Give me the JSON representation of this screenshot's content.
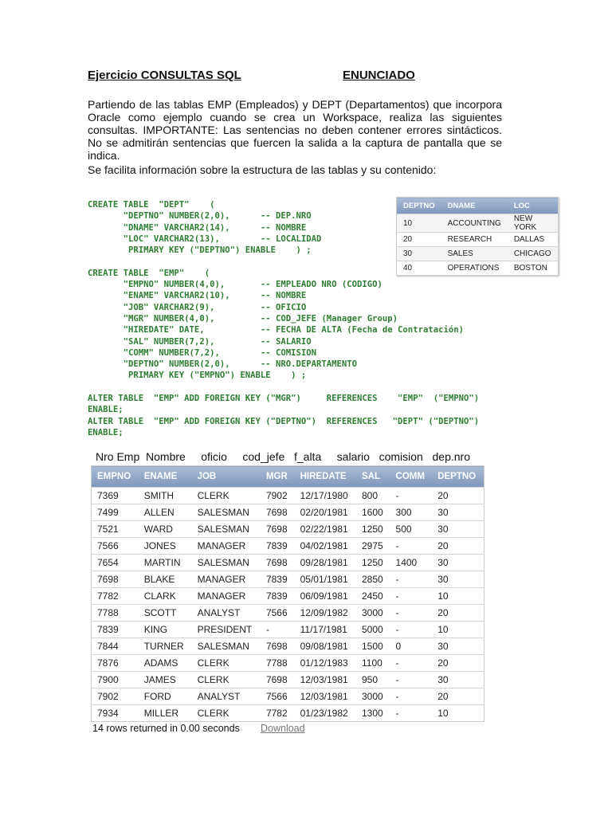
{
  "title_left": "Ejercicio CONSULTAS SQL",
  "title_right": "ENUNCIADO",
  "intro": "Partiendo de las tablas EMP (Empleados) y DEPT (Departamentos) que incorpora Oracle como ejemplo cuando se crea un Workspace, realiza las siguientes consultas. IMPORTANTE: Las sentencias no deben contener errores sintácticos. No se admitirán sentencias que fuercen la salida a la captura de pantalla que se indica.",
  "info": "Se facilita información sobre la estructura de las tablas y su contenido:",
  "code": "CREATE TABLE  \"DEPT\"    (\n       \"DEPTNO\" NUMBER(2,0),      -- DEP.NRO\n       \"DNAME\" VARCHAR2(14),      -- NOMBRE\n       \"LOC\" VARCHAR2(13),        -- LOCALIDAD\n        PRIMARY KEY (\"DEPTNO\") ENABLE    ) ;\n\nCREATE TABLE  \"EMP\"    (\n       \"EMPNO\" NUMBER(4,0),       -- EMPLEADO NRO (CODIGO)\n       \"ENAME\" VARCHAR2(10),      -- NOMBRE\n       \"JOB\" VARCHAR2(9),         -- OFICIO\n       \"MGR\" NUMBER(4,0),         -- COD_JEFE (Manager Group)\n       \"HIREDATE\" DATE,           -- FECHA DE ALTA (Fecha de Contratación)\n       \"SAL\" NUMBER(7,2),         -- SALARIO\n       \"COMM\" NUMBER(7,2),        -- COMISION\n       \"DEPTNO\" NUMBER(2,0),      -- NRO.DEPARTAMENTO\n        PRIMARY KEY (\"EMPNO\") ENABLE    ) ;\n\nALTER TABLE  \"EMP\" ADD FOREIGN KEY (\"MGR\")     REFERENCES    \"EMP\"  (\"EMPNO\")\nENABLE;\nALTER TABLE  \"EMP\" ADD FOREIGN KEY (\"DEPTNO\")  REFERENCES   \"DEPT\" (\"DEPTNO\")\nENABLE;",
  "dept": {
    "headers": [
      "DEPTNO",
      "DNAME",
      "LOC"
    ],
    "rows": [
      [
        "10",
        "ACCOUNTING",
        "NEW YORK"
      ],
      [
        "20",
        "RESEARCH",
        "DALLAS"
      ],
      [
        "30",
        "SALES",
        "CHICAGO"
      ],
      [
        "40",
        "OPERATIONS",
        "BOSTON"
      ]
    ]
  },
  "emp_labels": "Nro Emp  Nombre     oficio     cod_jefe   f_alta     salario   comision   dep.nro",
  "emp": {
    "headers": [
      "EMPNO",
      "ENAME",
      "JOB",
      "MGR",
      "HIREDATE",
      "SAL",
      "COMM",
      "DEPTNO"
    ],
    "rows": [
      [
        "7369",
        "SMITH",
        "CLERK",
        "7902",
        "12/17/1980",
        "800",
        "-",
        "20"
      ],
      [
        "7499",
        "ALLEN",
        "SALESMAN",
        "7698",
        "02/20/1981",
        "1600",
        "300",
        "30"
      ],
      [
        "7521",
        "WARD",
        "SALESMAN",
        "7698",
        "02/22/1981",
        "1250",
        "500",
        "30"
      ],
      [
        "7566",
        "JONES",
        "MANAGER",
        "7839",
        "04/02/1981",
        "2975",
        "-",
        "20"
      ],
      [
        "7654",
        "MARTIN",
        "SALESMAN",
        "7698",
        "09/28/1981",
        "1250",
        "1400",
        "30"
      ],
      [
        "7698",
        "BLAKE",
        "MANAGER",
        "7839",
        "05/01/1981",
        "2850",
        "-",
        "30"
      ],
      [
        "7782",
        "CLARK",
        "MANAGER",
        "7839",
        "06/09/1981",
        "2450",
        "-",
        "10"
      ],
      [
        "7788",
        "SCOTT",
        "ANALYST",
        "7566",
        "12/09/1982",
        "3000",
        "-",
        "20"
      ],
      [
        "7839",
        "KING",
        "PRESIDENT",
        "-",
        "11/17/1981",
        "5000",
        "-",
        "10"
      ],
      [
        "7844",
        "TURNER",
        "SALESMAN",
        "7698",
        "09/08/1981",
        "1500",
        "0",
        "30"
      ],
      [
        "7876",
        "ADAMS",
        "CLERK",
        "7788",
        "01/12/1983",
        "1100",
        "-",
        "20"
      ],
      [
        "7900",
        "JAMES",
        "CLERK",
        "7698",
        "12/03/1981",
        "950",
        "-",
        "30"
      ],
      [
        "7902",
        "FORD",
        "ANALYST",
        "7566",
        "12/03/1981",
        "3000",
        "-",
        "20"
      ],
      [
        "7934",
        "MILLER",
        "CLERK",
        "7782",
        "01/23/1982",
        "1300",
        "-",
        "10"
      ]
    ]
  },
  "footer": {
    "rows_returned": "14 rows returned in 0.00 seconds",
    "download": "Download"
  }
}
